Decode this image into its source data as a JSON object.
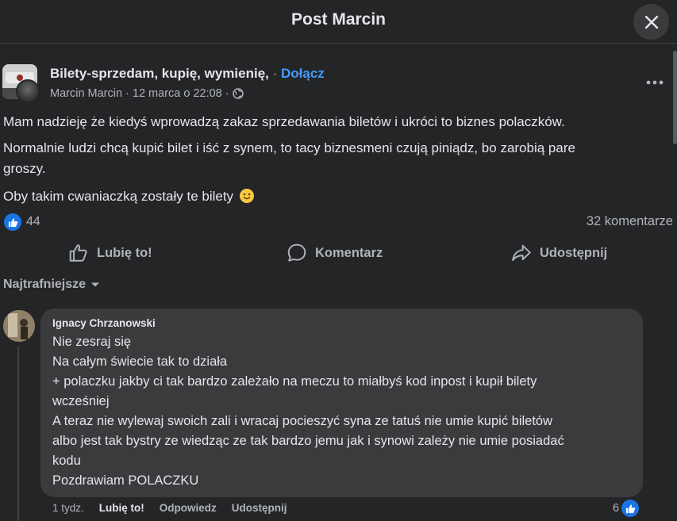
{
  "header": {
    "title": "Post Marcin"
  },
  "post": {
    "group_name": "Bilety-sprzedam, kupię, wymienię,",
    "separator": "·",
    "join_label": "Dołącz",
    "author": "Marcin Marcin",
    "date": "12 marca o 22:08",
    "paragraphs": {
      "p1": "Mam nadzieję że kiedyś wprowadzą zakaz sprzedawania biletów i ukróci to biznes polaczków.",
      "p2a": "Normalnie ludzi chcą kupić bilet i iść z synem, to tacy biznesmeni czują piniądz, bo zarobią pare",
      "p2b": "groszy.",
      "p3": "Oby takim cwaniaczką zostały te bilety"
    },
    "reaction_count": "44",
    "comments_count": "32 komentarze"
  },
  "actions": {
    "like": "Lubię to!",
    "comment": "Komentarz",
    "share": "Udostępnij"
  },
  "sort_label": "Najtrafniejsze",
  "comment": {
    "author": "Ignacy Chrzanowski",
    "lines": [
      "Nie zesraj się",
      "Na całym świecie tak to działa",
      "+ polaczku jakby ci tak bardzo zależało na meczu to miałbyś kod inpost i kupił bilety",
      "wcześniej",
      "A teraz nie wylewaj swoich zali i wracaj pocieszyć syna ze tatuś nie umie kupić biletów",
      "albo jest tak bystry ze wiedząc ze tak bardzo jemu jak i synowi zależy nie umie posiadać",
      "kodu",
      "Pozdrawiam POLACZKU"
    ],
    "time": "1 tydz.",
    "like": "Lubię to!",
    "reply": "Odpowiedz",
    "share": "Udostępnij",
    "reaction_count": "6"
  },
  "colors": {
    "background": "#242526",
    "bubble": "#3a3b3c",
    "link": "#4599ff",
    "like_blue": "#1b74e4",
    "text_primary": "#e4e6eb",
    "text_secondary": "#b0b3b8"
  }
}
